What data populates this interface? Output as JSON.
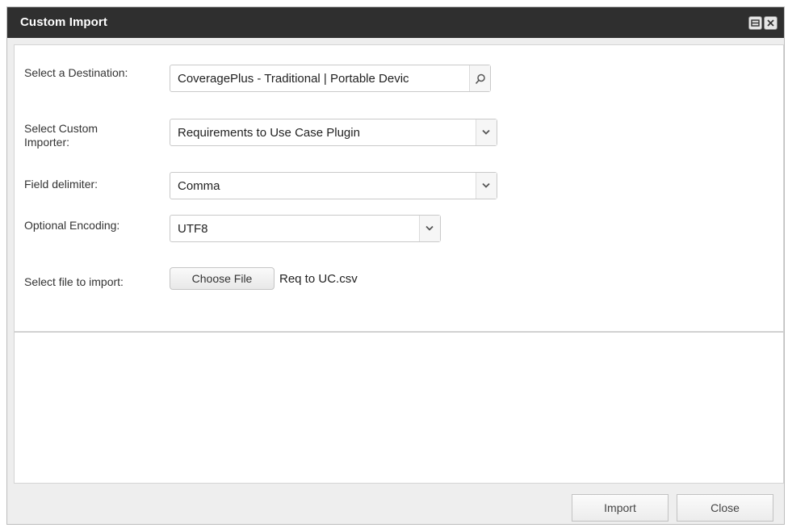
{
  "window": {
    "title": "Custom Import",
    "controls": [
      "minimize-icon",
      "close-icon"
    ]
  },
  "form": {
    "destination": {
      "label": "Select a Destination:",
      "value": "CoveragePlus - Traditional | Portable Devic",
      "icon": "search-icon"
    },
    "importer": {
      "label": "Select Custom Importer:",
      "value": "Requirements to Use Case Plugin",
      "icon": "chevron-down-icon"
    },
    "delimiter": {
      "label": "Field delimiter:",
      "value": "Comma",
      "icon": "chevron-down-icon"
    },
    "encoding": {
      "label": "Optional Encoding:",
      "value": "UTF8",
      "icon": "chevron-down-icon"
    },
    "file": {
      "label": "Select file to import:",
      "button_label": "Choose File",
      "filename": "Req to UC.csv"
    }
  },
  "footer": {
    "import_label": "Import",
    "close_label": "Close"
  },
  "colors": {
    "titlebar": "#2f2f2f",
    "dialog_bg": "#eeeeee",
    "panel_bg": "#ffffff"
  }
}
